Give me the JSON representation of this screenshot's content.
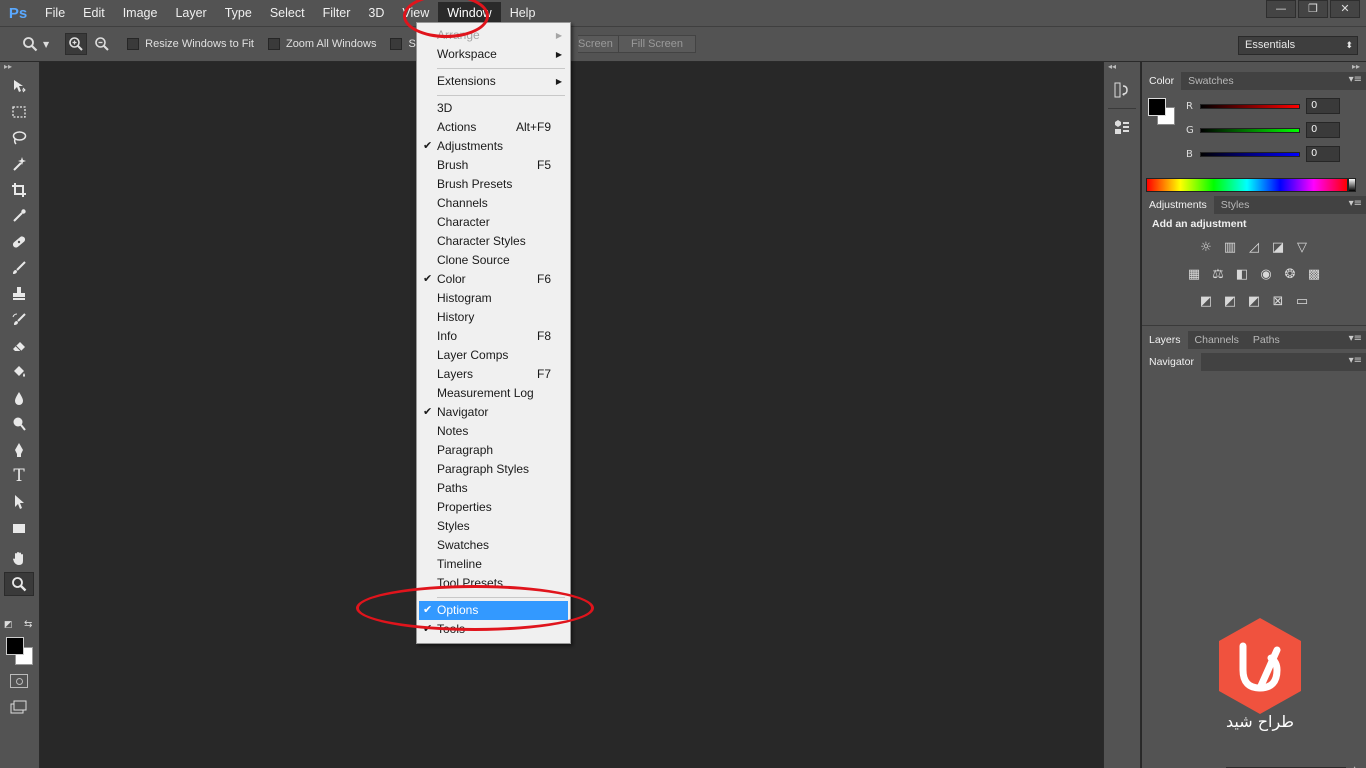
{
  "app": {
    "logo": "Ps",
    "window_controls": [
      "—",
      "❐",
      "✕"
    ]
  },
  "menubar": {
    "items": [
      "File",
      "Edit",
      "Image",
      "Layer",
      "Type",
      "Select",
      "Filter",
      "3D",
      "View",
      "Window",
      "Help"
    ],
    "active": "Window"
  },
  "options_bar": {
    "resize_windows": "Resize Windows to Fit",
    "zoom_all": "Zoom All Windows",
    "scrubby": "Scru",
    "screen_btn": "Screen",
    "fill_screen": "Fill Screen",
    "workspace": "Essentials"
  },
  "toolbar": {
    "tools": [
      "move-tool-icon",
      "marquee-tool-icon",
      "lasso-tool-icon",
      "magic-wand-icon",
      "crop-tool-icon",
      "eyedropper-icon",
      "healing-brush-icon",
      "brush-tool-icon",
      "clone-stamp-icon",
      "history-brush-icon",
      "eraser-icon",
      "paint-bucket-icon",
      "blur-tool-icon",
      "dodge-tool-icon",
      "pen-tool-icon",
      "type-tool-icon",
      "path-selection-icon",
      "rectangle-tool-icon",
      "hand-tool-icon",
      "zoom-tool-icon"
    ],
    "type_glyph": "T"
  },
  "dropdown": {
    "items": [
      {
        "label": "Arrange",
        "disabled": true,
        "submenu": true
      },
      {
        "label": "Workspace",
        "submenu": true
      },
      {
        "sep": true
      },
      {
        "label": "Extensions",
        "submenu": true
      },
      {
        "sep": true
      },
      {
        "label": "3D"
      },
      {
        "label": "Actions",
        "shortcut": "Alt+F9"
      },
      {
        "label": "Adjustments",
        "checked": true
      },
      {
        "label": "Brush",
        "shortcut": "F5"
      },
      {
        "label": "Brush Presets"
      },
      {
        "label": "Channels"
      },
      {
        "label": "Character"
      },
      {
        "label": "Character Styles"
      },
      {
        "label": "Clone Source"
      },
      {
        "label": "Color",
        "shortcut": "F6",
        "checked": true
      },
      {
        "label": "Histogram"
      },
      {
        "label": "History"
      },
      {
        "label": "Info",
        "shortcut": "F8"
      },
      {
        "label": "Layer Comps"
      },
      {
        "label": "Layers",
        "shortcut": "F7"
      },
      {
        "label": "Measurement Log"
      },
      {
        "label": "Navigator",
        "checked": true
      },
      {
        "label": "Notes"
      },
      {
        "label": "Paragraph"
      },
      {
        "label": "Paragraph Styles"
      },
      {
        "label": "Paths"
      },
      {
        "label": "Properties"
      },
      {
        "label": "Styles"
      },
      {
        "label": "Swatches"
      },
      {
        "label": "Timeline"
      },
      {
        "label": "Tool Presets"
      },
      {
        "sep": true
      },
      {
        "label": "Options",
        "checked": true,
        "highlight": true
      },
      {
        "label": "Tools",
        "checked": true
      }
    ]
  },
  "panels": {
    "color_tabs": [
      "Color",
      "Swatches"
    ],
    "r_label": "R",
    "g_label": "G",
    "b_label": "B",
    "r_value": "0",
    "g_value": "0",
    "b_value": "0",
    "adjustments_tabs": [
      "Adjustments",
      "Styles"
    ],
    "add_adjustment": "Add an adjustment",
    "layers_tabs": [
      "Layers",
      "Channels",
      "Paths"
    ],
    "navigator_tab": "Navigator"
  },
  "watermark": {
    "text": "طراح شید",
    "color": "#f0523e"
  },
  "colors": {
    "accent": "#3399ff",
    "annotation": "#e0141c"
  }
}
